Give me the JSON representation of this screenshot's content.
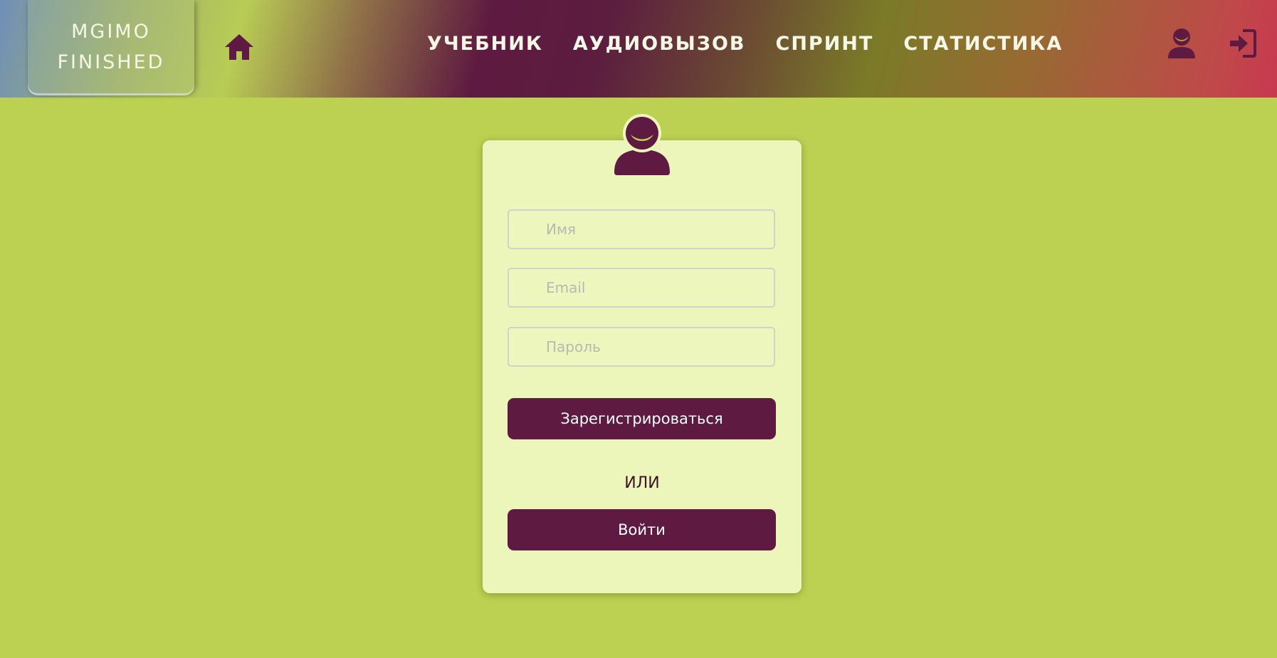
{
  "header": {
    "logo_line1": "MGIMO",
    "logo_line2": "FINISHED",
    "nav": [
      "УЧЕБНИК",
      "АУДИОВЫЗОВ",
      "СПРИНТ",
      "СТАТИСТИКА"
    ],
    "icons": {
      "home": "home-icon",
      "user": "user-icon",
      "login": "sign-in-icon"
    }
  },
  "form": {
    "avatar_icon": "user-avatar-icon",
    "name_placeholder": "Имя",
    "email_placeholder": "Email",
    "password_placeholder": "Пароль",
    "register_label": "Зарегистрироваться",
    "or_label": "ИЛИ",
    "login_label": "Войти"
  },
  "colors": {
    "accent": "#5e1a40",
    "background": "#bcd152",
    "card": "#ecf6bb"
  }
}
